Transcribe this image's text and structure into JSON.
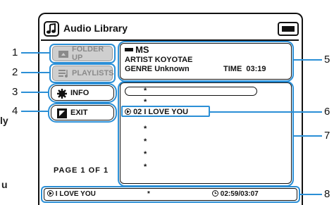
{
  "side_text": [
    "ly",
    "u"
  ],
  "header": {
    "title": "Audio Library"
  },
  "sidebar": {
    "folder_up": "FOLDER UP",
    "playlists": "PLAYLISTS",
    "info": "INFO",
    "exit": "EXIT",
    "page_label": "PAGE",
    "page_current": "1",
    "page_of": "OF",
    "page_total": "1"
  },
  "info_panel": {
    "source": "MS",
    "artist_label": "ARTIST",
    "artist": "KOYOTAE",
    "genre_label": "GENRE",
    "genre": "Unknown",
    "time_label": "TIME",
    "time": "03:19"
  },
  "list": {
    "rows": [
      "*",
      "*",
      "02 I LOVE YOU",
      "*",
      "*",
      "*",
      "*"
    ]
  },
  "status": {
    "track": "I LOVE YOU",
    "mid": "*",
    "time": "02:59/03:07"
  },
  "callouts": [
    "1",
    "2",
    "3",
    "4",
    "5",
    "6",
    "7",
    "8"
  ]
}
